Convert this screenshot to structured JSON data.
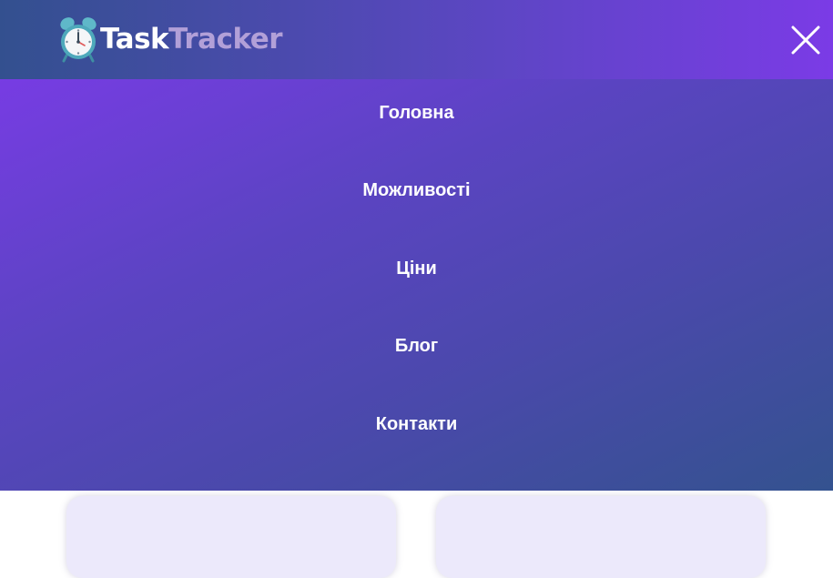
{
  "header": {
    "logo": {
      "icon": "alarm-clock-icon",
      "text_part1": "Task",
      "text_part2": "Tracker"
    },
    "close_icon": "close-icon"
  },
  "menu": {
    "items": [
      {
        "label": "Головна"
      },
      {
        "label": "Можливості"
      },
      {
        "label": "Ціни"
      },
      {
        "label": "Блог"
      },
      {
        "label": "Контакти"
      }
    ]
  },
  "colors": {
    "header_gradient_start": "#33508f",
    "header_gradient_end": "#7b3be6",
    "menu_gradient_start": "#773ce3",
    "menu_gradient_end": "#34528f",
    "logo_accent": "#b2a0d8",
    "card_background": "#ece9fb"
  }
}
